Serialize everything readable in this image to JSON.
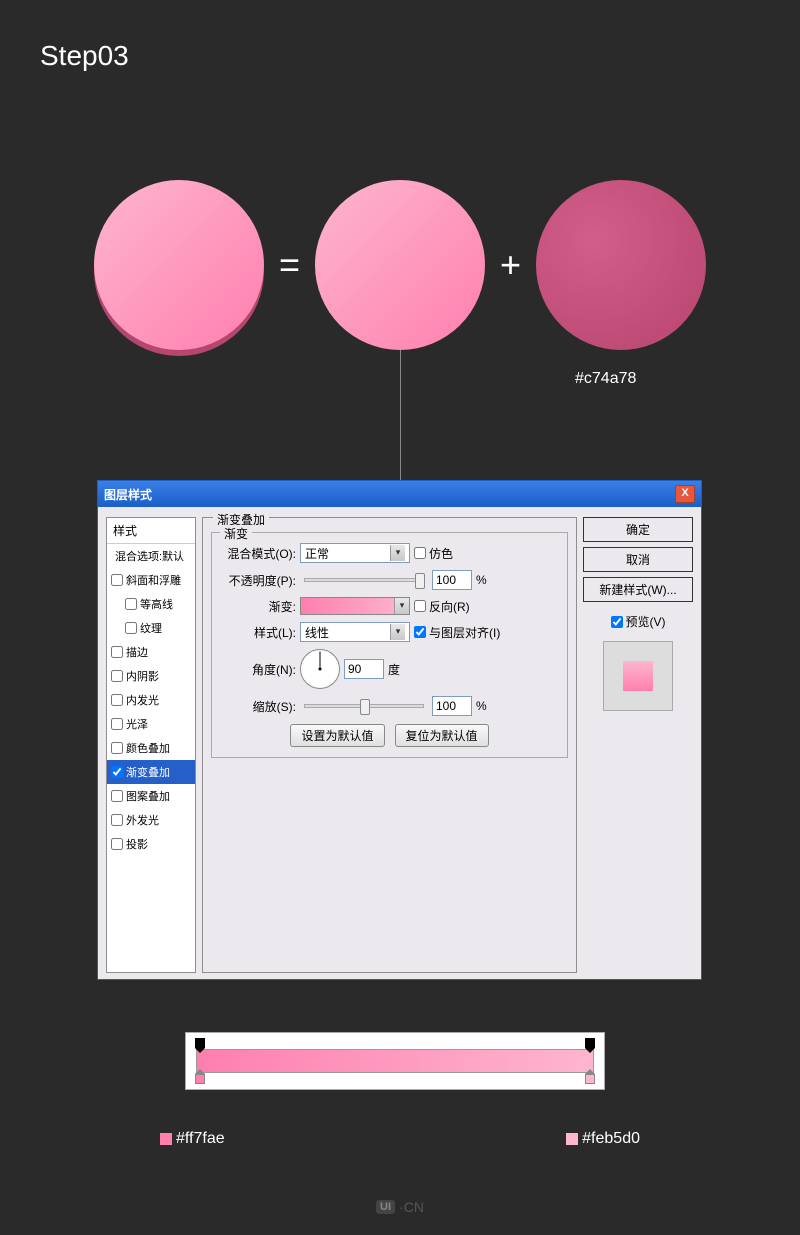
{
  "step_title": "Step03",
  "operators": {
    "equals": "=",
    "plus": "+"
  },
  "colors": {
    "circle3_hex": "#c74a78",
    "grad_left": "#ff7fae",
    "grad_right": "#feb5d0"
  },
  "dialog": {
    "title": "图层样式",
    "close": "X",
    "styles_header": "样式",
    "blend_options": "混合选项:默认",
    "items": [
      {
        "label": "斜面和浮雕",
        "checked": false
      },
      {
        "label": "等高线",
        "checked": false,
        "indent": true
      },
      {
        "label": "纹理",
        "checked": false,
        "indent": true
      },
      {
        "label": "描边",
        "checked": false
      },
      {
        "label": "内阴影",
        "checked": false
      },
      {
        "label": "内发光",
        "checked": false
      },
      {
        "label": "光泽",
        "checked": false
      },
      {
        "label": "颜色叠加",
        "checked": false
      },
      {
        "label": "渐变叠加",
        "checked": true,
        "active": true
      },
      {
        "label": "图案叠加",
        "checked": false
      },
      {
        "label": "外发光",
        "checked": false
      },
      {
        "label": "投影",
        "checked": false
      }
    ],
    "panel_title": "渐变叠加",
    "fieldset_legend": "渐变",
    "labels": {
      "blend_mode": "混合模式(O):",
      "opacity": "不透明度(P):",
      "gradient": "渐变:",
      "style": "样式(L):",
      "angle": "角度(N):",
      "scale": "缩放(S):",
      "dither": "仿色",
      "reverse": "反向(R)",
      "align": "与图层对齐(I)",
      "degree": "度",
      "percent": "%"
    },
    "values": {
      "blend_mode": "正常",
      "opacity": "100",
      "style": "线性",
      "angle": "90",
      "scale": "100",
      "dither": false,
      "reverse": false,
      "align": true
    },
    "buttons": {
      "set_default": "设置为默认值",
      "reset_default": "复位为默认值",
      "ok": "确定",
      "cancel": "取消",
      "new_style": "新建样式(W)...",
      "preview": "预览(V)"
    },
    "preview_checked": true
  },
  "watermark": {
    "badge": "UI",
    "suffix": "·CN"
  },
  "chart_data": {
    "type": "gradient",
    "stops": [
      {
        "position": 0,
        "color": "#ff7fae"
      },
      {
        "position": 100,
        "color": "#feb5d0"
      }
    ],
    "angle": 90,
    "opacity": 100,
    "scale": 100
  }
}
